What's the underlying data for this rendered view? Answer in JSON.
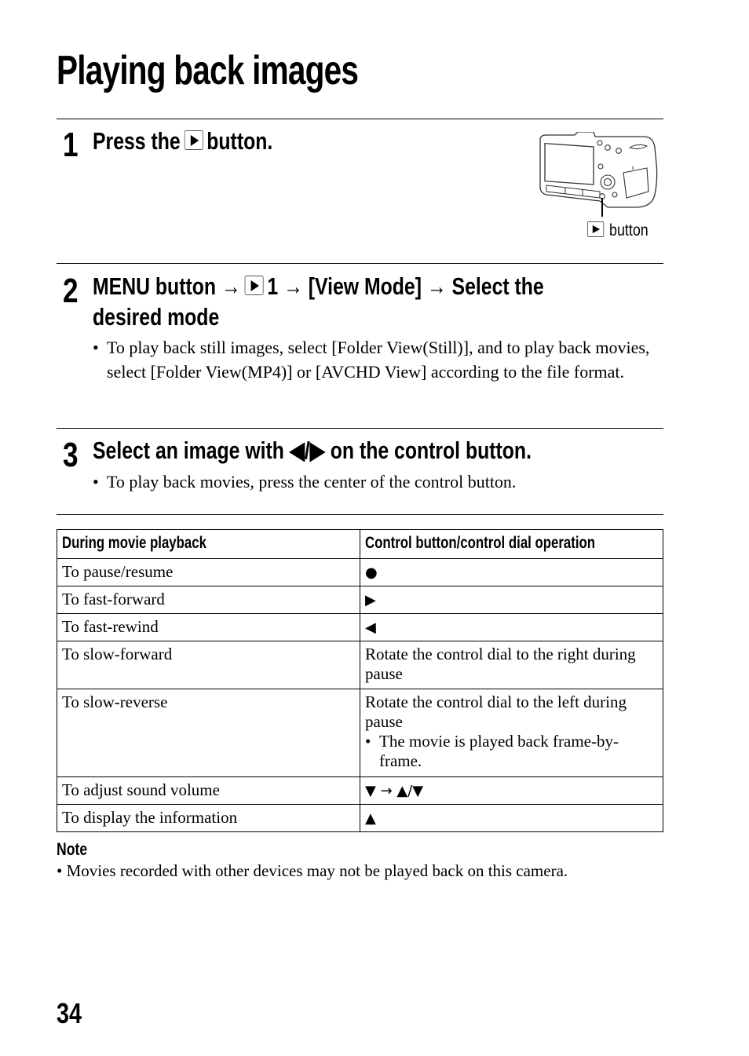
{
  "page": {
    "title": "Playing back images",
    "page_number": "34"
  },
  "steps": [
    {
      "number": "1",
      "heading_before": "Press the",
      "heading_icon": "playback-icon",
      "heading_after": "button.",
      "illustration": {
        "icon": "camera-back-illustration",
        "label_icon": "playback-icon",
        "label": "button"
      }
    },
    {
      "number": "2",
      "heading_line1_a": "MENU button",
      "arrow": "→",
      "heading_line1_b": "1",
      "heading_line1_c": "[View Mode]",
      "heading_line1_d": "Select the",
      "heading_line2": "desired mode",
      "bullets": [
        {
          "bullet": "•",
          "text": "To play back still images, select [Folder View(Still)], and to play back movies, select [Folder View(MP4)] or [AVCHD View] according to the file format."
        }
      ]
    },
    {
      "number": "3",
      "heading": "Select an image with ◀/▶ on the control button.",
      "bullets": [
        {
          "bullet": "•",
          "text": "To play back movies, press the center of the control button."
        }
      ]
    }
  ],
  "table": {
    "headers": [
      "During movie playback",
      "Control button/control dial operation"
    ],
    "rows": [
      {
        "action": "To pause/resume",
        "operation": "●"
      },
      {
        "action": "To fast-forward",
        "operation": "▶"
      },
      {
        "action": "To fast-rewind",
        "operation": "◀"
      },
      {
        "action": "To slow-forward",
        "operation": "Rotate the control dial to the right during pause"
      },
      {
        "action": "To slow-reverse",
        "operation": "Rotate the control dial to the left during pause",
        "sub_bullet": "The movie is played back frame-by-frame."
      },
      {
        "action": "To adjust sound volume",
        "operation": "▼ → ▲/▼"
      },
      {
        "action": "To display the information",
        "operation": "▲"
      }
    ]
  },
  "note": {
    "label": "Note",
    "bullet": "•",
    "text": "Movies recorded with other devices may not be played back on this camera."
  }
}
